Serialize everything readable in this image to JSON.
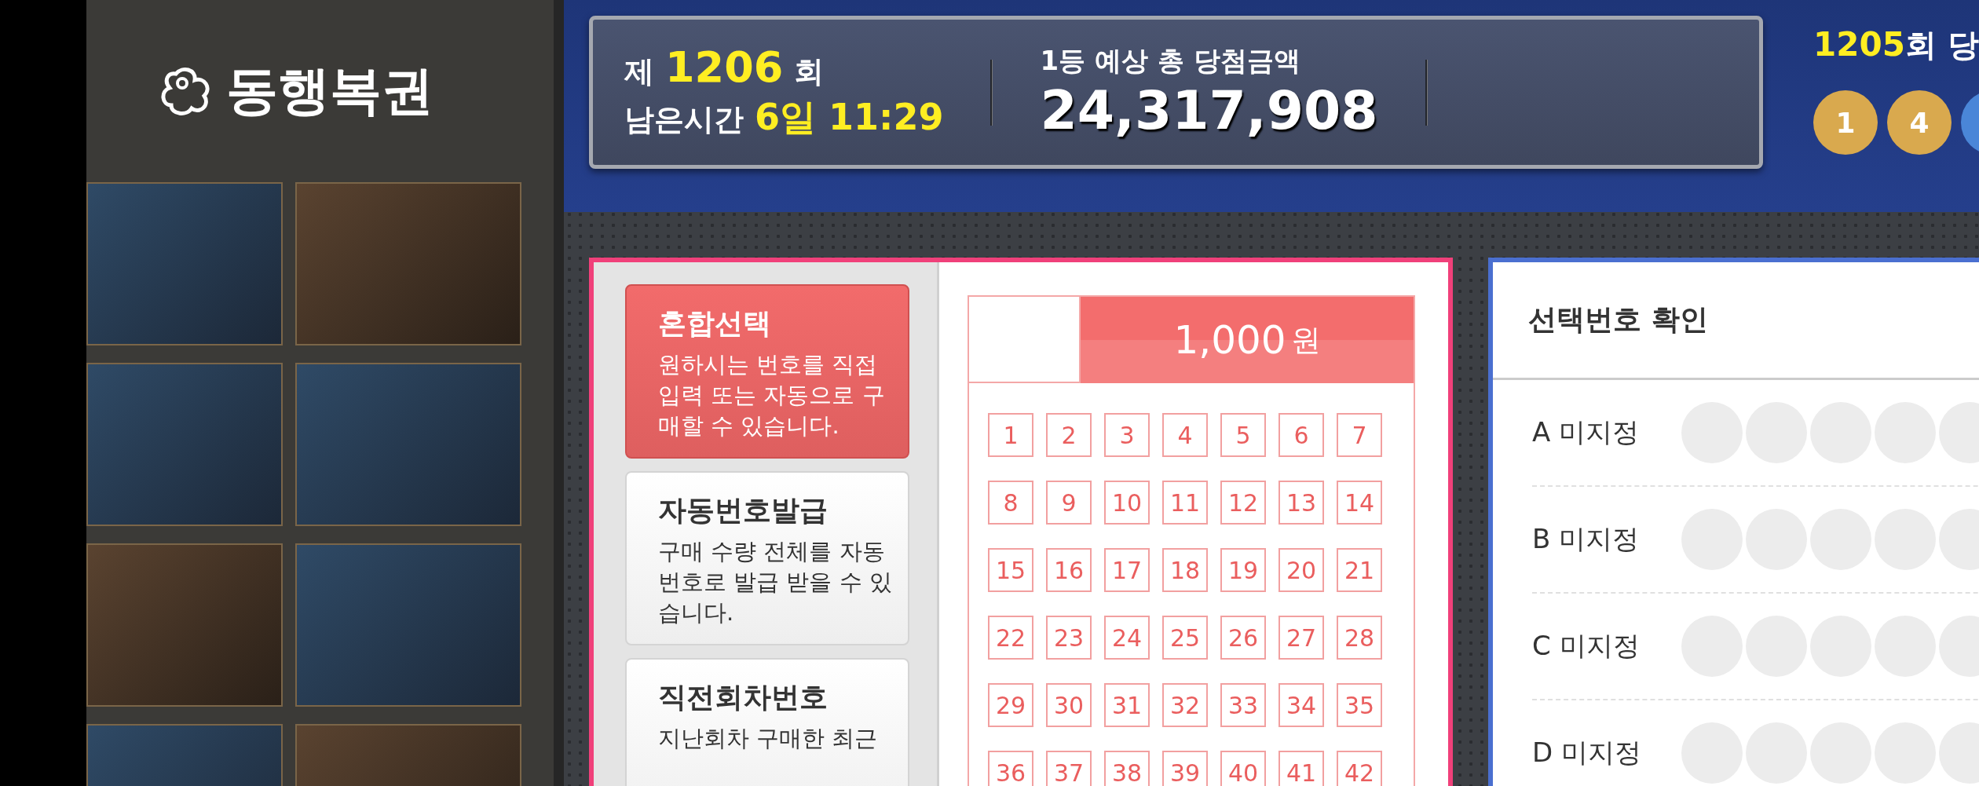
{
  "sidebar": {
    "logo": "동행복권",
    "games": [
      {
        "kind": "lottery"
      },
      {
        "kind": "lottery"
      },
      {
        "kind": "lottery"
      },
      {
        "kind": "lottery"
      },
      {
        "kind": "lottery"
      },
      {
        "kind": "lottery"
      },
      {
        "kind": "lottery"
      },
      {
        "kind": "lottery"
      }
    ]
  },
  "header": {
    "round_prefix": "제",
    "round": "1206",
    "round_suffix": "회",
    "time_label": "남은시간",
    "time_left": "6일 11:29",
    "jackpot_label": "1등 예상 총 당첨금액",
    "jackpot": "24,317,908",
    "previous": {
      "round": "1205",
      "suffix": "회 당",
      "balls": [
        {
          "number": "1",
          "color": "#d9a94e"
        },
        {
          "number": "4",
          "color": "#d9a94e"
        },
        {
          "color": "#4a86d8"
        }
      ]
    }
  },
  "modes": [
    {
      "title": "혼합선택",
      "description": "원하시는 번호를 직접 입력 또는 자동으로 구매할 수 있습니다.",
      "selected": true
    },
    {
      "title": "자동번호발급",
      "description": "구매 수량 전체를 자동 번호로 발급 받을 수 있습니다.",
      "selected": false
    },
    {
      "title": "직전회차번호",
      "description": "지난회차 구매한 최근",
      "selected": false
    }
  ],
  "ticket": {
    "price": "1,000",
    "currency": "원",
    "numbers": [
      {
        "label": "1",
        "selected": false
      },
      {
        "label": "2",
        "selected": false
      },
      {
        "label": "3",
        "selected": false
      },
      {
        "label": "4",
        "selected": false
      },
      {
        "label": "5",
        "selected": false
      },
      {
        "label": "6",
        "selected": false
      },
      {
        "label": "7",
        "selected": false
      },
      {
        "label": "8",
        "selected": false
      },
      {
        "label": "9",
        "selected": false
      },
      {
        "label": "10",
        "selected": false
      },
      {
        "label": "11",
        "selected": false
      },
      {
        "label": "12",
        "selected": false
      },
      {
        "label": "13",
        "selected": false
      },
      {
        "label": "14",
        "selected": false
      },
      {
        "label": "15",
        "selected": false
      },
      {
        "label": "16",
        "selected": false
      },
      {
        "label": "17",
        "selected": false
      },
      {
        "label": "18",
        "selected": false
      },
      {
        "label": "19",
        "selected": false
      },
      {
        "label": "20",
        "selected": false
      },
      {
        "label": "21",
        "selected": false
      },
      {
        "label": "22",
        "selected": false
      },
      {
        "label": "23",
        "selected": false
      },
      {
        "label": "24",
        "selected": false
      },
      {
        "label": "25",
        "selected": false
      },
      {
        "label": "26",
        "selected": false
      },
      {
        "label": "27",
        "selected": false
      },
      {
        "label": "28",
        "selected": false
      },
      {
        "label": "29",
        "selected": false
      },
      {
        "label": "30",
        "selected": false
      },
      {
        "label": "31",
        "selected": false
      },
      {
        "label": "32",
        "selected": false
      },
      {
        "label": "33",
        "selected": false
      },
      {
        "label": "34",
        "selected": false
      },
      {
        "label": "35",
        "selected": false
      },
      {
        "label": "36",
        "selected": false
      },
      {
        "label": "37",
        "selected": false
      },
      {
        "label": "38",
        "selected": false
      },
      {
        "label": "39",
        "selected": false
      },
      {
        "label": "40",
        "selected": false
      },
      {
        "label": "41",
        "selected": false
      },
      {
        "label": "42",
        "selected": false
      }
    ]
  },
  "confirm": {
    "title": "선택번호 확인",
    "rows": [
      {
        "slot": "A",
        "status": "미지정"
      },
      {
        "slot": "B",
        "status": "미지정"
      },
      {
        "slot": "C",
        "status": "미지정"
      },
      {
        "slot": "D",
        "status": "미지정"
      }
    ]
  }
}
